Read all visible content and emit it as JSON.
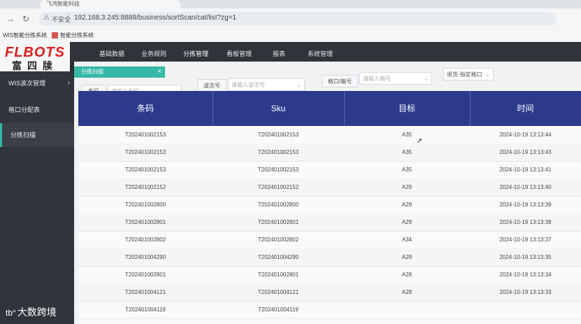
{
  "browser": {
    "tab_title": "飞鸿智能科技",
    "insecure_label": "不安全",
    "url": "192.168.3.245:8889/business/sortScan/cat/list?zg=1",
    "bookmarks": [
      "WIS智能分拣系统",
      "智能分拣系统"
    ]
  },
  "logo": {
    "main": "FLBOTS",
    "sub": "富四牍"
  },
  "topnav": [
    "基础数据",
    "业务规则",
    "分拣管理",
    "看板管理",
    "报表",
    "系统管理"
  ],
  "topnav_active": "分拣管理",
  "sidebar": {
    "items": [
      {
        "label": "WIS波次管理",
        "arrow": "›"
      },
      {
        "label": "格口分配表"
      },
      {
        "label": "分拣扫描"
      }
    ],
    "active": "分拣扫描"
  },
  "subtab": {
    "label": "分拣扫描",
    "close": "×"
  },
  "filters": {
    "barcode": {
      "label": "条码",
      "placeholder": "请输入条码"
    },
    "wave": {
      "label": "波次号",
      "placeholder": "请输入波次号"
    },
    "slot": {
      "label": "格口/箱号",
      "placeholder": "请输入箱号"
    },
    "mode": {
      "value": "退货-指定格口"
    }
  },
  "table": {
    "headers": [
      "条码",
      "Sku",
      "目标",
      "时间"
    ],
    "rows": [
      [
        "T202401002153",
        "T202401002153",
        "A35",
        "2024-10-19 13:13:44"
      ],
      [
        "T202401002153",
        "T202401002153",
        "A35",
        "2024-10-19 13:13:43"
      ],
      [
        "T202401002153",
        "T202401002153",
        "A35",
        "2024-10-19 13:13:41"
      ],
      [
        "T202401002152",
        "T202401002152",
        "A29",
        "2024-10-19 13:13:40"
      ],
      [
        "T202401002800",
        "T202401002800",
        "A29",
        "2024-10-19 13:13:39"
      ],
      [
        "T202401002801",
        "T202401002801",
        "A29",
        "2024-10-19 13:13:38"
      ],
      [
        "T202401002802",
        "T202401002802",
        "A34",
        "2024-10-19 13:13:37"
      ],
      [
        "T202401004290",
        "T202401004290",
        "A29",
        "2024-10-19 13:13:35"
      ],
      [
        "T202401002801",
        "T202401002801",
        "A28",
        "2024-10-19 13:13:34"
      ],
      [
        "T202401004121",
        "T202401004121",
        "A28",
        "2024-10-19 13:13:33"
      ],
      [
        "T202401004119",
        "T202401004119",
        "",
        ""
      ]
    ]
  },
  "watermark": {
    "logo": "tb°",
    "text": "大数跨境"
  },
  "colors": {
    "accent": "#36b8a6",
    "table_header": "#2d3a8c",
    "brand_red": "#d81e1e"
  }
}
